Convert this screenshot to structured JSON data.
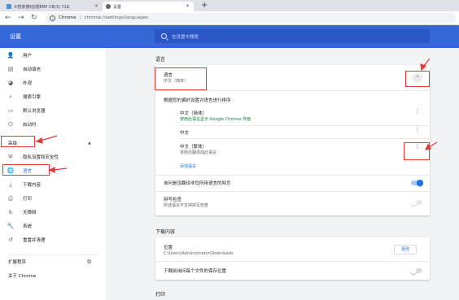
{
  "tabs": [
    {
      "title": "※管家婆Ⅱ创想ERP CB(3) Y18.",
      "close": "✕"
    },
    {
      "title": "设置",
      "close": "✕"
    }
  ],
  "newtab": "+",
  "omnibox": {
    "host": "Chrome",
    "separator": "|",
    "path": "chrome://settings/languages"
  },
  "header": {
    "title": "设置",
    "search_placeholder": "在设置中搜索"
  },
  "sidebar": {
    "items": [
      {
        "label": "用户",
        "icon": "person-icon"
      },
      {
        "label": "自动填充",
        "icon": "clipboard-icon"
      },
      {
        "label": "外观",
        "icon": "palette-icon"
      },
      {
        "label": "搜索引擎",
        "icon": "search-icon"
      },
      {
        "label": "默认浏览器",
        "icon": "browser-icon"
      },
      {
        "label": "启动时",
        "icon": "power-icon"
      }
    ],
    "advanced": {
      "label": "高级",
      "expand": "▲"
    },
    "advanced_items": [
      {
        "label": "隐私设置和安全性",
        "icon": "shield-icon"
      },
      {
        "label": "语言",
        "icon": "globe-icon"
      },
      {
        "label": "下载内容",
        "icon": "download-icon"
      },
      {
        "label": "打印",
        "icon": "print-icon"
      },
      {
        "label": "无障碍",
        "icon": "accessibility-icon"
      },
      {
        "label": "系统",
        "icon": "wrench-icon"
      },
      {
        "label": "重置并清理",
        "icon": "history-icon"
      }
    ],
    "extensions": "扩展程序",
    "about": "关于 Chrome"
  },
  "languages": {
    "section_title": "语言",
    "language": {
      "label": "语言",
      "value": "中文（简体）"
    },
    "order_hint": "根据您的偏好设置对语言进行排序",
    "items": [
      {
        "name": "中文（简体）",
        "note": "使用此语言显示 Google Chrome 界面",
        "note_style": "green"
      },
      {
        "name": "中文",
        "note": "",
        "note_style": ""
      },
      {
        "name": "中文（繁体）",
        "note": "将网页翻译成此语言",
        "note_style": "gray"
      }
    ],
    "add_language": "添加语言",
    "translate_offer": {
      "label": "询问是否翻译非您所用语言的网页",
      "enabled": true
    },
    "spellcheck": {
      "label": "拼写检查",
      "sub": "所选语言不支持拼写检查",
      "enabled": false
    }
  },
  "downloads": {
    "section_title": "下载内容",
    "location": {
      "label": "位置",
      "path": "C:\\Users\\Administrator\\Downloads",
      "button": "更改"
    },
    "ask": {
      "label": "下载前询问每个文件的保存位置",
      "enabled": false
    }
  },
  "print": {
    "section_title": "打印"
  },
  "colors": {
    "header": "#3367d6",
    "accent": "#1a73e8",
    "annotation": "#e53935",
    "status_green": "#188038"
  }
}
